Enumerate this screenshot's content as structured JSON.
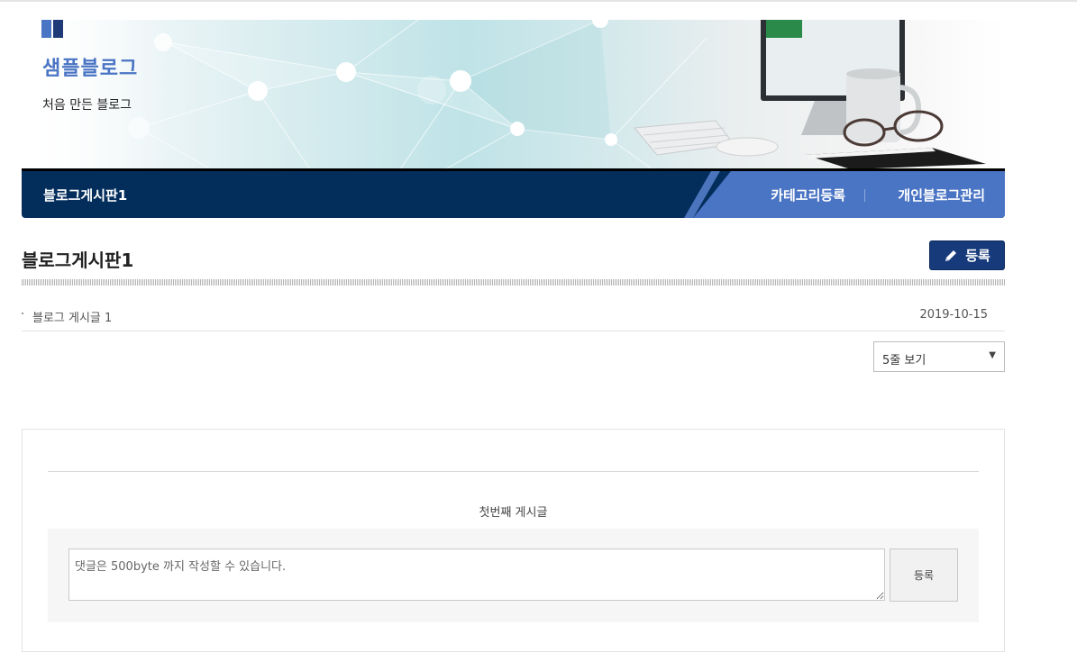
{
  "header": {
    "site_title": "샘플블로그",
    "site_description": "처음 만든 블로그"
  },
  "nav": {
    "current_board": "블로그게시판1",
    "links": [
      {
        "label": "카테고리등록"
      },
      {
        "label": "개인블로그관리"
      }
    ]
  },
  "board": {
    "title": "블로그게시판1",
    "write_label": "등록",
    "posts": [
      {
        "title": "블로그 게시글 1",
        "date": "2019-10-15"
      }
    ],
    "rows_select": {
      "selected": "5줄 보기"
    }
  },
  "detail": {
    "content": "첫번째 게시글",
    "comment_placeholder": "댓글은 500byte 까지 작성할 수 있습니다.",
    "comment_submit_label": "등록"
  },
  "colors": {
    "brand_blue": "#4a74c4",
    "nav_dark": "#032e5c",
    "button_navy": "#163a7a"
  }
}
